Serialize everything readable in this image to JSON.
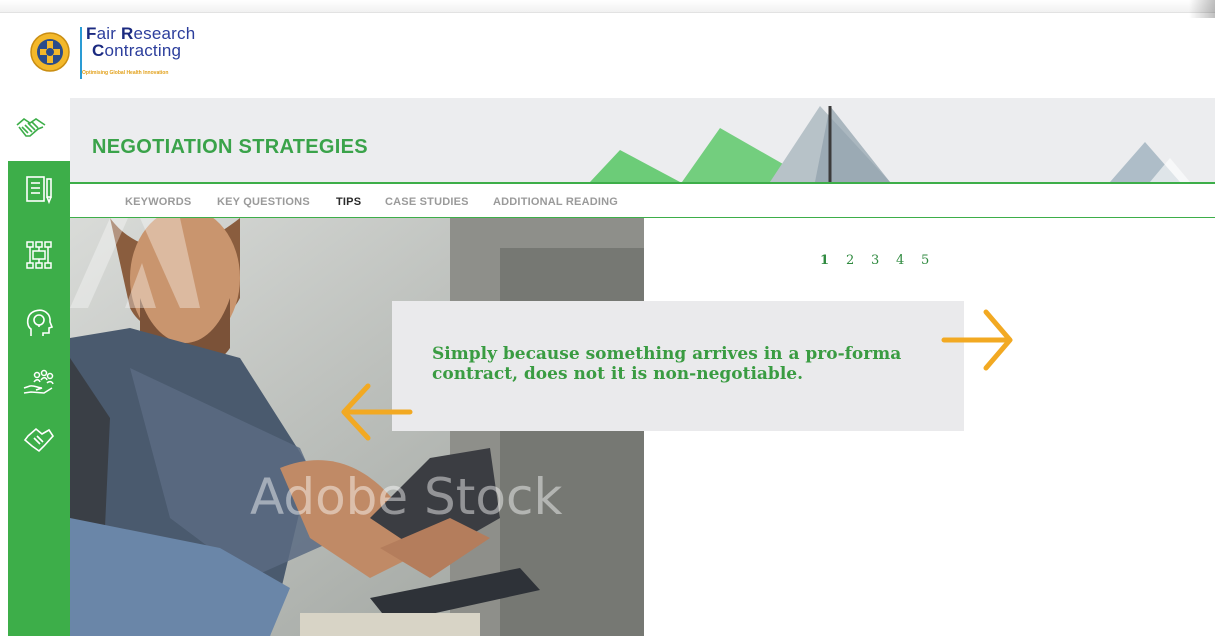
{
  "brand": {
    "line1_initial": "F",
    "line1_a": "air ",
    "line1_initial2": "R",
    "line1_b": "esearch",
    "line2_initial": "C",
    "line2_b": "ontracting",
    "tagline": "Optimising Global Health Innovation"
  },
  "banner": {
    "title": "NEGOTIATION STRATEGIES"
  },
  "tabs": [
    {
      "label": "KEYWORDS",
      "active": false
    },
    {
      "label": "KEY QUESTIONS",
      "active": false
    },
    {
      "label": "TIPS",
      "active": true
    },
    {
      "label": "CASE STUDIES",
      "active": false
    },
    {
      "label": "ADDITIONAL READING",
      "active": false
    }
  ],
  "sidebar": {
    "icons": [
      "handshake-icon",
      "document-pen-icon",
      "org-chart-icon",
      "head-idea-icon",
      "hand-people-icon",
      "puzzle-handshake-icon"
    ]
  },
  "pager": {
    "pages": [
      "1",
      "2",
      "3",
      "4",
      "5"
    ],
    "current": "1"
  },
  "quote": {
    "text": "Simply because something arrives in a pro-forma contract, does not it is non-negotiable."
  },
  "photo": {
    "watermark": "Adobe Stock"
  },
  "colors": {
    "green": "#3dae49",
    "arrow": "#f2a922",
    "banner_bg": "#ecedef",
    "quote_bg": "#eaeaec"
  }
}
